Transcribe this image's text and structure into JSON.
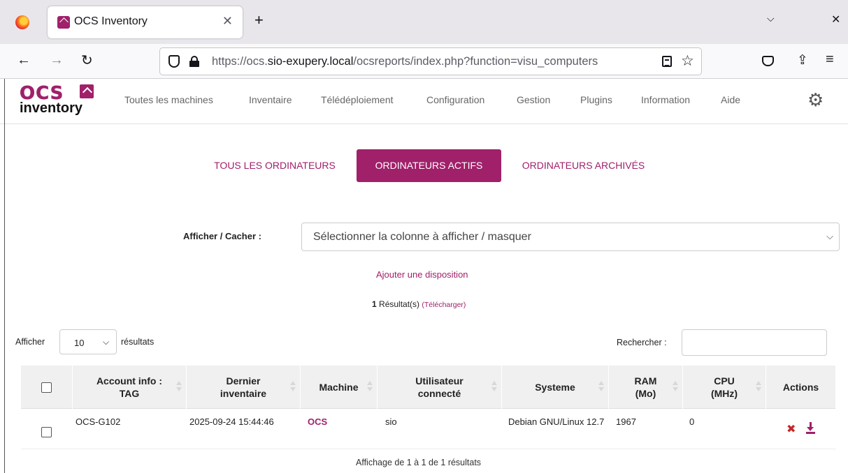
{
  "browser": {
    "tab_title": "OCS Inventory",
    "url_prefix": "https://ocs.",
    "url_domain": "sio-exupery.local",
    "url_path": "/ocsreports/index.php?function=visu_computers"
  },
  "nav": {
    "items": [
      "Toutes les machines",
      "Inventaire",
      "Télédéploiement",
      "Configuration",
      "Gestion",
      "Plugins",
      "Information",
      "Aide"
    ]
  },
  "logo": {
    "top": "OCS",
    "bottom": "inventory"
  },
  "tabs": {
    "all": "TOUS LES ORDINATEURS",
    "active": "ORDINATEURS ACTIFS",
    "archived": "ORDINATEURS ARCHIVÉS"
  },
  "columns_filter": {
    "label": "Afficher / Cacher :",
    "placeholder": "Sélectionner la colonne à afficher / masquer"
  },
  "add_layout": "Ajouter une disposition",
  "results": {
    "count": "1",
    "text": "Résultat(s)",
    "download": "(Télécharger)"
  },
  "length": {
    "prefix": "Afficher",
    "value": "10",
    "suffix": "résultats"
  },
  "search": {
    "label": "Rechercher :"
  },
  "table": {
    "headers": {
      "tag": "Account info : TAG",
      "last": "Dernier inventaire",
      "machine": "Machine",
      "user": "Utilisateur connecté",
      "system": "Systeme",
      "ram": "RAM (Mo)",
      "cpu": "CPU (MHz)",
      "actions": "Actions"
    },
    "rows": [
      {
        "tag": "OCS-G102",
        "last": "2025-09-24 15:44:46",
        "machine": "OCS",
        "user": "sio",
        "system": "Debian GNU/Linux 12.7",
        "ram": "1967",
        "cpu": "0"
      }
    ]
  },
  "footer": "Affichage de 1 à 1 de 1 résultats",
  "colors": {
    "brand": "#a0206a",
    "delete": "#c62828"
  }
}
